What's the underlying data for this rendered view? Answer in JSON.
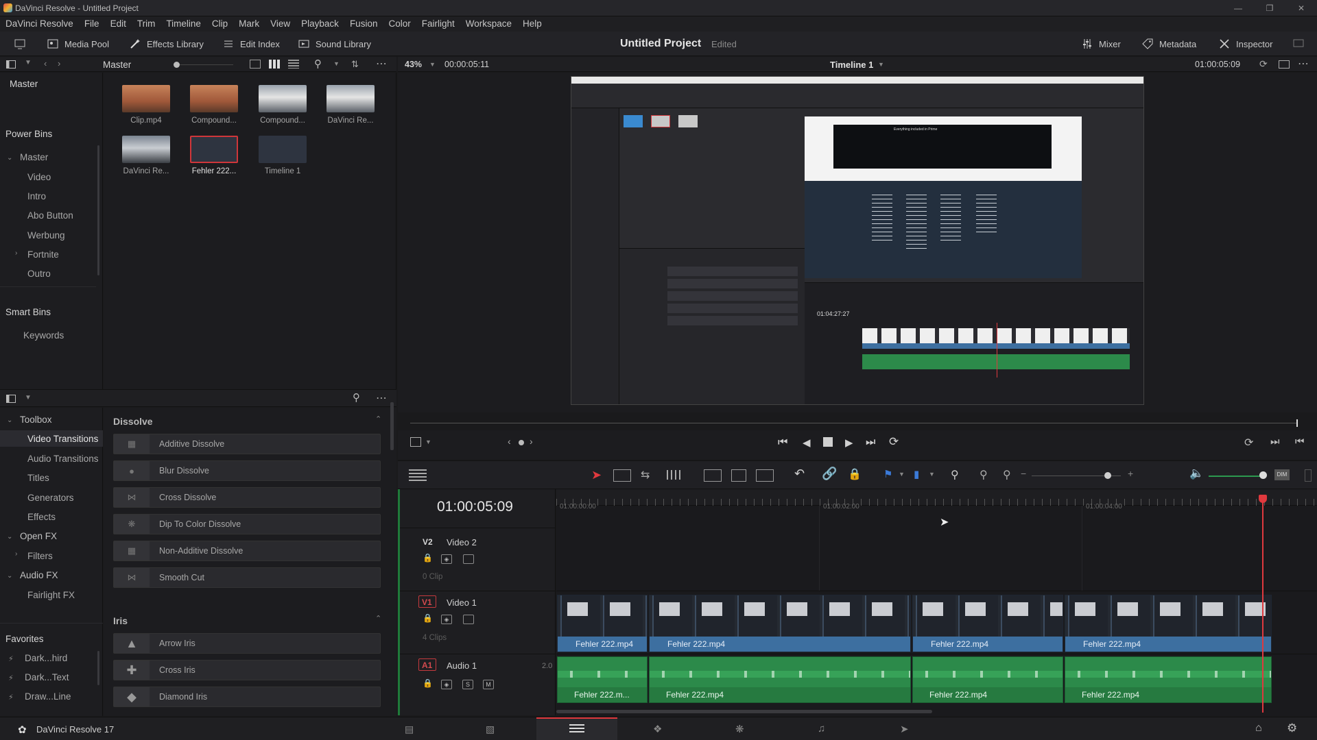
{
  "window": {
    "title": "DaVinci Resolve - Untitled Project"
  },
  "menu": [
    "DaVinci Resolve",
    "File",
    "Edit",
    "Trim",
    "Timeline",
    "Clip",
    "Mark",
    "View",
    "Playback",
    "Fusion",
    "Color",
    "Fairlight",
    "Workspace",
    "Help"
  ],
  "toolbar": {
    "media_pool": "Media Pool",
    "effects_library": "Effects Library",
    "edit_index": "Edit Index",
    "sound_library": "Sound Library",
    "project_title": "Untitled Project",
    "project_status": "Edited",
    "mixer": "Mixer",
    "metadata": "Metadata",
    "inspector": "Inspector"
  },
  "mediabar": {
    "bin": "Master"
  },
  "viewerbar": {
    "zoom": "43%",
    "source_tc": "00:00:05:11",
    "timeline_name": "Timeline 1",
    "record_tc": "01:00:05:09"
  },
  "bins": {
    "master": "Master",
    "power_bins": "Power Bins",
    "power_master": "Master",
    "items": [
      "Video",
      "Intro",
      "Abo Button",
      "Werbung",
      "Fortnite",
      "Outro"
    ],
    "smart_bins": "Smart Bins",
    "keywords": "Keywords"
  },
  "pool_clips": [
    "Clip.mp4",
    "Compound...",
    "Compound...",
    "DaVinci Re...",
    "DaVinci Re...",
    "Fehler 222...",
    "Timeline 1"
  ],
  "fx_tree": {
    "toolbox": "Toolbox",
    "video_transitions": "Video Transitions",
    "audio_transitions": "Audio Transitions",
    "titles": "Titles",
    "generators": "Generators",
    "effects": "Effects",
    "open_fx": "Open FX",
    "filters": "Filters",
    "audio_fx": "Audio FX",
    "fairlight_fx": "Fairlight FX",
    "favorites": "Favorites",
    "fav_items": [
      "Dark...hird",
      "Dark...Text",
      "Draw...Line"
    ]
  },
  "fx_list": {
    "dissolve_header": "Dissolve",
    "dissolve": [
      "Additive Dissolve",
      "Blur Dissolve",
      "Cross Dissolve",
      "Dip To Color Dissolve",
      "Non-Additive Dissolve",
      "Smooth Cut"
    ],
    "iris_header": "Iris",
    "iris": [
      "Arrow Iris",
      "Cross Iris",
      "Diamond Iris"
    ]
  },
  "nested_screen": {
    "mini_tc": "01:04:27:27",
    "mini_heading": "Everything included in Prime"
  },
  "timeline": {
    "timecode": "01:00:05:09",
    "ruler": [
      "01:00:00:00",
      "01:00:02:00",
      "01:00:04:00"
    ],
    "v2": {
      "tag": "V2",
      "name": "Video 2",
      "sub": "0 Clip"
    },
    "v1": {
      "tag": "V1",
      "name": "Video 1",
      "sub": "4 Clips"
    },
    "a1": {
      "tag": "A1",
      "name": "Audio 1",
      "level": "2.0"
    },
    "clip_names": [
      "Fehler 222.mp4",
      "Fehler 222.mp4",
      "Fehler 222.mp4",
      "Fehler 222.mp4"
    ],
    "audio_names": [
      "Fehler 222.m...",
      "Fehler 222.mp4",
      "Fehler 222.mp4",
      "Fehler 222.mp4"
    ],
    "solo": "S",
    "mute": "M"
  },
  "bottom": {
    "app": "DaVinci Resolve 17"
  },
  "colors": {
    "accent_red": "#e0393e",
    "clip_blue": "#3d6fa0",
    "audio_green": "#2c8a4a",
    "playhead": "#e0393e"
  }
}
